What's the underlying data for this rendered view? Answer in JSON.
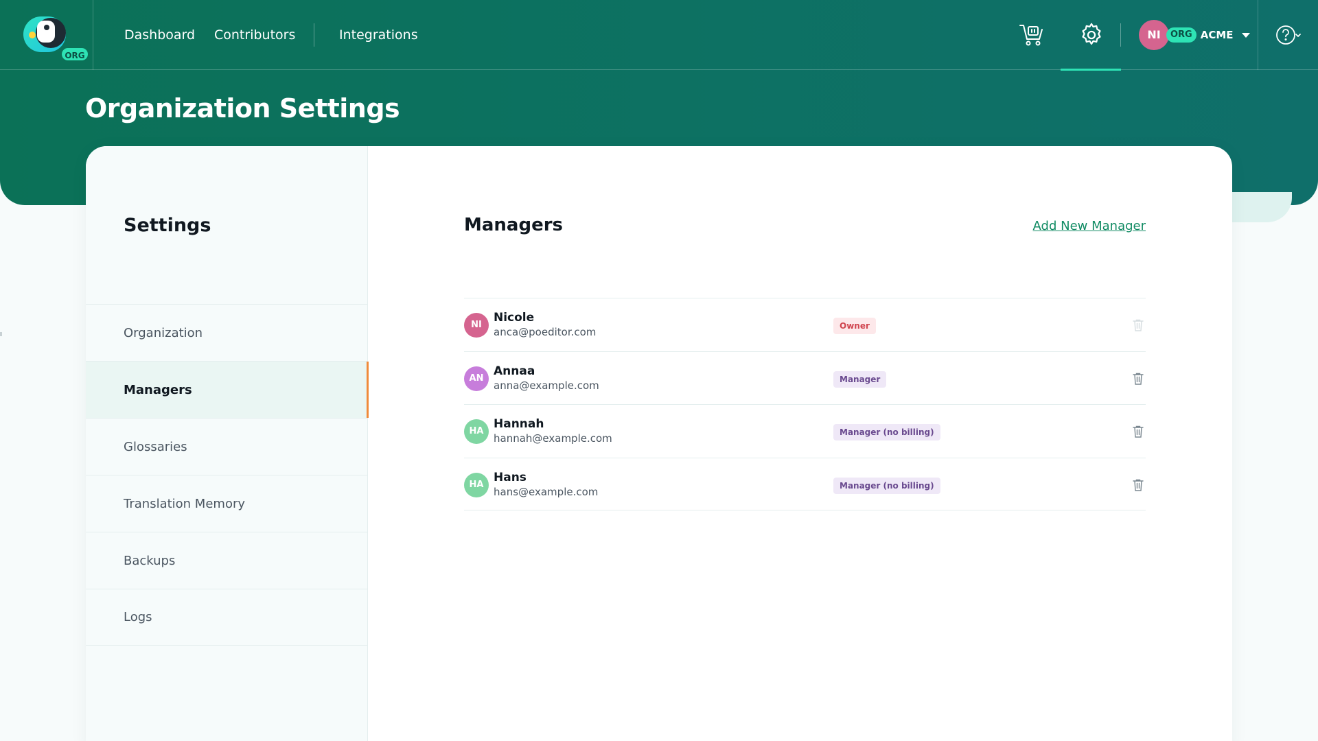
{
  "app": {
    "logo_badge": "ORG",
    "colors": {
      "brand": "#0b7157",
      "accent": "#2ee3b5",
      "link": "#0f8a62",
      "active_indicator": "#f08a3a"
    }
  },
  "nav": {
    "items": [
      {
        "label": "Dashboard"
      },
      {
        "label": "Contributors"
      },
      {
        "label": "Integrations"
      }
    ],
    "icons": [
      "cart-icon",
      "gear-icon",
      "help-icon"
    ]
  },
  "account": {
    "initials": "NI",
    "badge": "ORG",
    "name": "ACME"
  },
  "page": {
    "title": "Organization Settings"
  },
  "sidebar": {
    "title": "Settings",
    "items": [
      {
        "label": "Organization"
      },
      {
        "label": "Managers"
      },
      {
        "label": "Glossaries"
      },
      {
        "label": "Translation Memory"
      },
      {
        "label": "Backups"
      },
      {
        "label": "Logs"
      }
    ]
  },
  "managers": {
    "title": "Managers",
    "add_label": "Add New Manager",
    "list": [
      {
        "initials": "NI",
        "name": "Nicole",
        "email": "anca@poeditor.com",
        "role": "Owner",
        "avatar_color": "#d5648f",
        "role_bg": "#fde8ea",
        "role_fg": "#d0454f",
        "deletable": false
      },
      {
        "initials": "AN",
        "name": "Annaa",
        "email": "anna@example.com",
        "role": "Manager",
        "avatar_color": "#c77ddb",
        "role_bg": "#efe8f7",
        "role_fg": "#6a4a8f",
        "deletable": true
      },
      {
        "initials": "HA",
        "name": "Hannah",
        "email": "hannah@example.com",
        "role": "Manager (no billing)",
        "avatar_color": "#7fd6a2",
        "role_bg": "#efe8f7",
        "role_fg": "#6a4a8f",
        "deletable": true
      },
      {
        "initials": "HA",
        "name": "Hans",
        "email": "hans@example.com",
        "role": "Manager (no billing)",
        "avatar_color": "#7fd6a2",
        "role_bg": "#efe8f7",
        "role_fg": "#6a4a8f",
        "deletable": true
      }
    ]
  }
}
